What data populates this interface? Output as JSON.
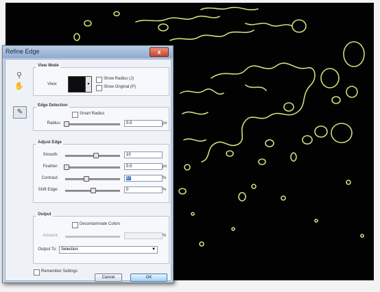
{
  "dialog": {
    "title": "Refine Edge",
    "close_glyph": "x"
  },
  "tools": {
    "zoom_icon": "magnifier-icon",
    "hand_icon": "hand-icon",
    "brush_icon": "refine-radius-brush-icon"
  },
  "view_mode": {
    "title": "View Mode",
    "view_label": "View:",
    "show_radius": "Show Radius (J)",
    "show_original": "Show Original (P)",
    "show_radius_checked": false,
    "show_original_checked": false
  },
  "edge_detection": {
    "title": "Edge Detection",
    "smart_radius": "Smart Radius",
    "smart_radius_checked": false,
    "radius_label": "Radius:",
    "radius_value": "0.0",
    "radius_unit": "px"
  },
  "adjust_edge": {
    "title": "Adjust Edge",
    "rows": [
      {
        "label": "Smooth:",
        "value": "10",
        "unit": "",
        "level": 0.55,
        "selected": false
      },
      {
        "label": "Feather:",
        "value": "0.0",
        "unit": "px",
        "level": 0.0,
        "selected": false
      },
      {
        "label": "Contrast:",
        "value": "37",
        "unit": "%",
        "level": 0.37,
        "selected": true
      },
      {
        "label": "Shift Edge:",
        "value": "0",
        "unit": "%",
        "level": 0.5,
        "selected": false
      }
    ]
  },
  "output": {
    "title": "Output",
    "decontaminate": "Decontaminate Colors",
    "decontaminate_checked": false,
    "amount_label": "Amount:",
    "amount_unit": "%",
    "output_to_label": "Output To:",
    "output_to_value": "Selection"
  },
  "remember": {
    "label": "Remember Settings",
    "checked": false
  },
  "buttons": {
    "cancel": "Cancel",
    "ok": "OK"
  },
  "colors": {
    "canvas_bg": "#020202",
    "edge_stroke": "#c9e27a",
    "dialog_frame": "#c6d3e3",
    "ok_accent": "#a9d1ef"
  }
}
